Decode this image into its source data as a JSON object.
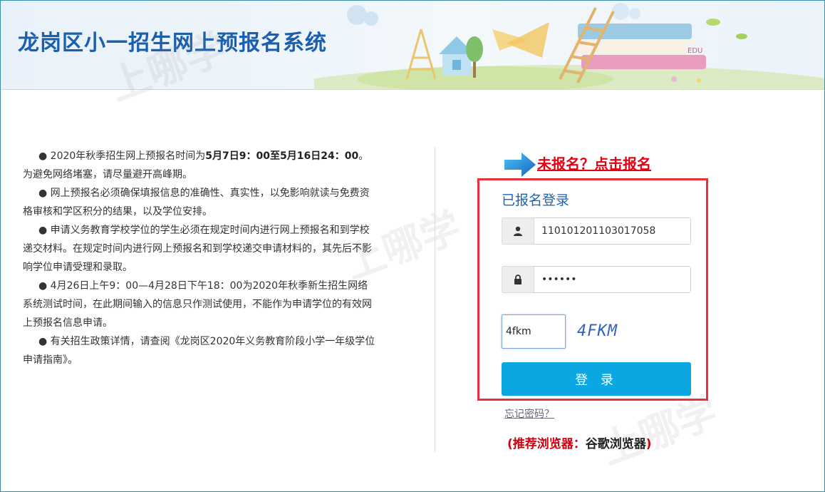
{
  "header": {
    "title": "龙岗区小一招生网上预报名系统",
    "book_label": "EDU"
  },
  "notice": {
    "items": [
      {
        "pre": "● 2020年秋季招生网上预报名时间为",
        "bold": "5月7日9：00至5月16日24：00",
        "post": "。为避免网络堵塞，请尽量避开高峰期。"
      },
      {
        "pre": "● 网上预报名必须确保填报信息的准确性、真实性，以免影响就读与免费资格审核和学区积分的结果，以及学位安排。",
        "bold": "",
        "post": ""
      },
      {
        "pre": "● 申请义务教育学校学位的学生必须在规定时间内进行网上预报名和到学校递交材料。在规定时间内进行网上预报名和到学校递交申请材料的，其先后不影响学位申请受理和录取。",
        "bold": "",
        "post": ""
      },
      {
        "pre": "● 4月26日上午9：00—4月28日下午18：00为2020年秋季新生招生网络系统测试时间，在此期间输入的信息只作测试使用，不能作为申请学位的有效网上预报名信息申请。",
        "bold": "",
        "post": ""
      },
      {
        "pre": "● 有关招生政策详情，请查阅《龙岗区2020年义务教育阶段小学一年级学位申请指南》。",
        "bold": "",
        "post": ""
      }
    ]
  },
  "register": {
    "link_label": "未报名？点击报名"
  },
  "login": {
    "title": "已报名登录",
    "username_value": "110101201103017058",
    "password_value": "123456",
    "captcha_value": "4fkm",
    "captcha_image_text": "4FKM",
    "submit_label": "登 录",
    "forgot_label": "忘记密码？"
  },
  "browser_tip": {
    "prefix": "(推荐浏览器：",
    "name": "谷歌浏览器",
    "suffix": ")"
  },
  "colors": {
    "title_blue": "#1b5fad",
    "login_blue": "#0ba7e3",
    "highlight_red": "#e8313c",
    "link_red": "#e60012"
  },
  "icons": {
    "username": "user-icon",
    "password": "lock-icon",
    "register": "arrow-right-icon"
  }
}
